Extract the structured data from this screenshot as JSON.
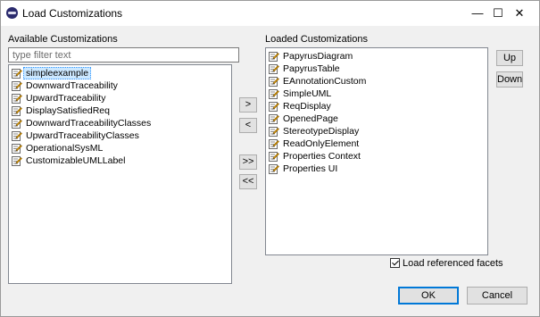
{
  "window": {
    "title": "Load Customizations"
  },
  "titlebar_buttons": {
    "minimize": "—",
    "maximize": "☐",
    "close": "✕"
  },
  "available": {
    "label": "Available Customizations",
    "filter_placeholder": "type filter text",
    "items": [
      "simpleexample",
      "DownwardTraceability",
      "UpwardTraceability",
      "DisplaySatisfiedReq",
      "DownwardTraceabilityClasses",
      "UpwardTraceabilityClasses",
      "OperationalSysML",
      "CustomizableUMLLabel"
    ],
    "selected_index": 0
  },
  "loaded": {
    "label": "Loaded Customizations",
    "items": [
      "PapyrusDiagram",
      "PapyrusTable",
      "EAnnotationCustom",
      "SimpleUML",
      "ReqDisplay",
      "OpenedPage",
      "StereotypeDisplay",
      "ReadOnlyElement",
      "Properties Context",
      "Properties UI"
    ]
  },
  "transfer": {
    "add": ">",
    "remove": "<",
    "add_all": ">>",
    "remove_all": "<<"
  },
  "order": {
    "up": "Up",
    "down": "Down"
  },
  "load_referenced": {
    "label": "Load referenced facets",
    "checked": true
  },
  "footer": {
    "ok": "OK",
    "cancel": "Cancel"
  },
  "colors": {
    "selection": "#cce8ff",
    "accent": "#0078d7"
  }
}
